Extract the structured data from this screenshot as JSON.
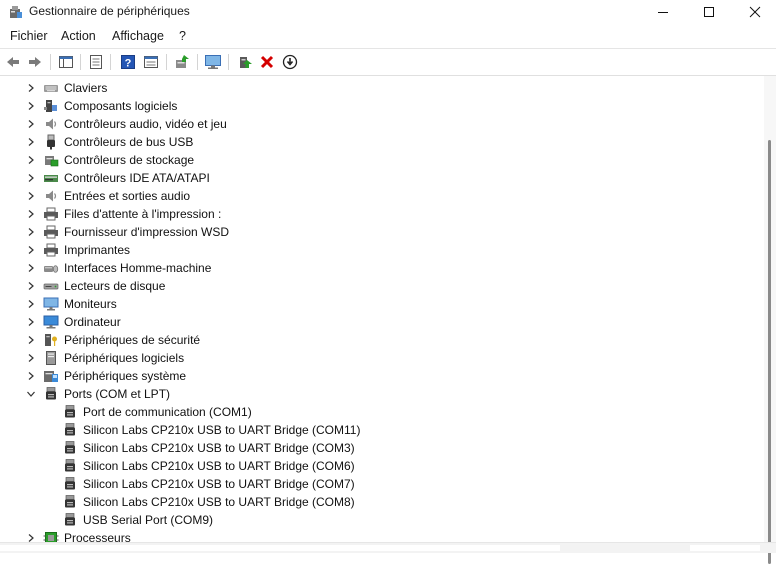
{
  "window": {
    "title": "Gestionnaire de périphériques"
  },
  "menu": [
    "Fichier",
    "Action",
    "Affichage",
    "?"
  ],
  "toolbar": [
    "back-icon",
    "forward-icon",
    "console-tree-icon",
    "properties-icon",
    "help-icon",
    "details-icon",
    "scan-hardware-icon",
    "monitor-icon",
    "update-driver-icon",
    "uninstall-icon",
    "disable-device-icon"
  ],
  "categories": [
    {
      "label": "Claviers",
      "icon": "keyboard-icon",
      "expanded": false
    },
    {
      "label": "Composants logiciels",
      "icon": "software-components-icon",
      "expanded": false
    },
    {
      "label": "Contrôleurs audio, vidéo et jeu",
      "icon": "speaker-icon",
      "expanded": false
    },
    {
      "label": "Contrôleurs de bus USB",
      "icon": "usb-icon",
      "expanded": false
    },
    {
      "label": "Contrôleurs de stockage",
      "icon": "storage-controller-icon",
      "expanded": false
    },
    {
      "label": "Contrôleurs IDE ATA/ATAPI",
      "icon": "ide-controller-icon",
      "expanded": false
    },
    {
      "label": "Entrées et sorties audio",
      "icon": "speaker-icon",
      "expanded": false
    },
    {
      "label": "Files d'attente à l'impression :",
      "icon": "printer-icon",
      "expanded": false
    },
    {
      "label": "Fournisseur d'impression WSD",
      "icon": "printer-icon",
      "expanded": false
    },
    {
      "label": "Imprimantes",
      "icon": "printer-icon",
      "expanded": false
    },
    {
      "label": "Interfaces Homme-machine",
      "icon": "hid-icon",
      "expanded": false
    },
    {
      "label": "Lecteurs de disque",
      "icon": "disk-drive-icon",
      "expanded": false
    },
    {
      "label": "Moniteurs",
      "icon": "monitor-icon",
      "expanded": false
    },
    {
      "label": "Ordinateur",
      "icon": "computer-icon",
      "expanded": false
    },
    {
      "label": "Périphériques de sécurité",
      "icon": "security-device-icon",
      "expanded": false
    },
    {
      "label": "Périphériques logiciels",
      "icon": "software-device-icon",
      "expanded": false
    },
    {
      "label": "Périphériques système",
      "icon": "system-device-icon",
      "expanded": false
    },
    {
      "label": "Ports (COM et LPT)",
      "icon": "port-icon",
      "expanded": true,
      "children": [
        "Port de communication (COM1)",
        "Silicon Labs CP210x USB to UART Bridge (COM11)",
        "Silicon Labs CP210x USB to UART Bridge (COM3)",
        "Silicon Labs CP210x USB to UART Bridge (COM6)",
        "Silicon Labs CP210x USB to UART Bridge (COM7)",
        "Silicon Labs CP210x USB to UART Bridge (COM8)",
        "USB Serial Port (COM9)"
      ]
    },
    {
      "label": "Processeurs",
      "icon": "processor-icon",
      "expanded": false
    }
  ],
  "colors": {
    "accent": "#0067c0",
    "close_red": "#d40000",
    "green": "#2a9d2a"
  }
}
